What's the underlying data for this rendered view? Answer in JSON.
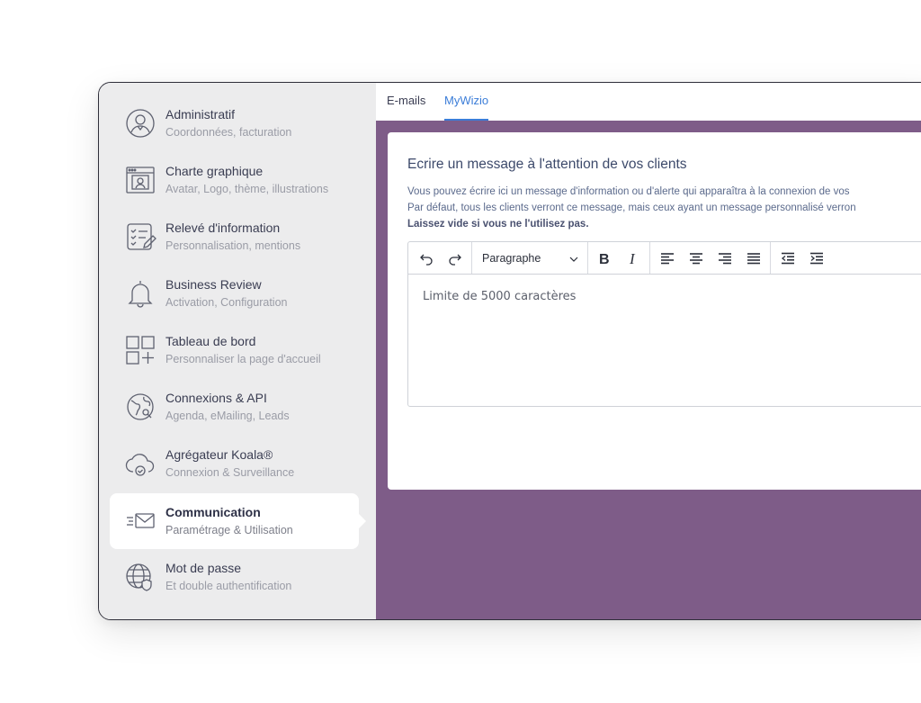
{
  "sidebar": {
    "items": [
      {
        "title": "Administratif",
        "subtitle": "Coordonnées, facturation",
        "icon": "user-circle-icon"
      },
      {
        "title": "Charte graphique",
        "subtitle": "Avatar, Logo, thème, illustrations",
        "icon": "browser-avatar-icon"
      },
      {
        "title": "Relevé d'information",
        "subtitle": "Personnalisation, mentions",
        "icon": "checklist-edit-icon"
      },
      {
        "title": "Business Review",
        "subtitle": "Activation, Configuration",
        "icon": "bell-icon"
      },
      {
        "title": "Tableau de bord",
        "subtitle": "Personnaliser la page d'accueil",
        "icon": "dashboard-grid-icon"
      },
      {
        "title": "Connexions & API",
        "subtitle": "Agenda, eMailing, Leads",
        "icon": "globe-link-icon"
      },
      {
        "title": "Agrégateur Koala®",
        "subtitle": "Connexion & Surveillance",
        "icon": "cloud-check-icon"
      },
      {
        "title": "Communication",
        "subtitle": "Paramétrage & Utilisation",
        "icon": "envelope-send-icon",
        "active": true
      },
      {
        "title": "Mot de passe",
        "subtitle": "Et double authentification",
        "icon": "globe-shield-icon"
      }
    ]
  },
  "tabs": [
    {
      "label": "E-mails",
      "active": false
    },
    {
      "label": "MyWizio",
      "active": true
    }
  ],
  "card": {
    "title": "Ecrire un message à l'attention de vos clients",
    "desc_line1": "Vous pouvez écrire ici un message d'information ou d'alerte qui apparaîtra à la connexion de vos",
    "desc_line2": "Par défaut, tous les clients verront ce message, mais ceux ayant un message personnalisé verron",
    "desc_line3": "Laissez vide si vous ne l'utilisez pas."
  },
  "editor": {
    "format_select": "Paragraphe",
    "placeholder": "Limite de 5000 caractères",
    "toolbar": [
      "undo-icon",
      "redo-icon",
      "bold-icon",
      "italic-icon",
      "align-left-icon",
      "align-center-icon",
      "align-right-icon",
      "align-justify-icon",
      "outdent-icon",
      "indent-icon"
    ]
  },
  "colors": {
    "accent": "#3b7dd8",
    "main_background": "#7e5c88",
    "sidebar_background": "#ececed"
  }
}
